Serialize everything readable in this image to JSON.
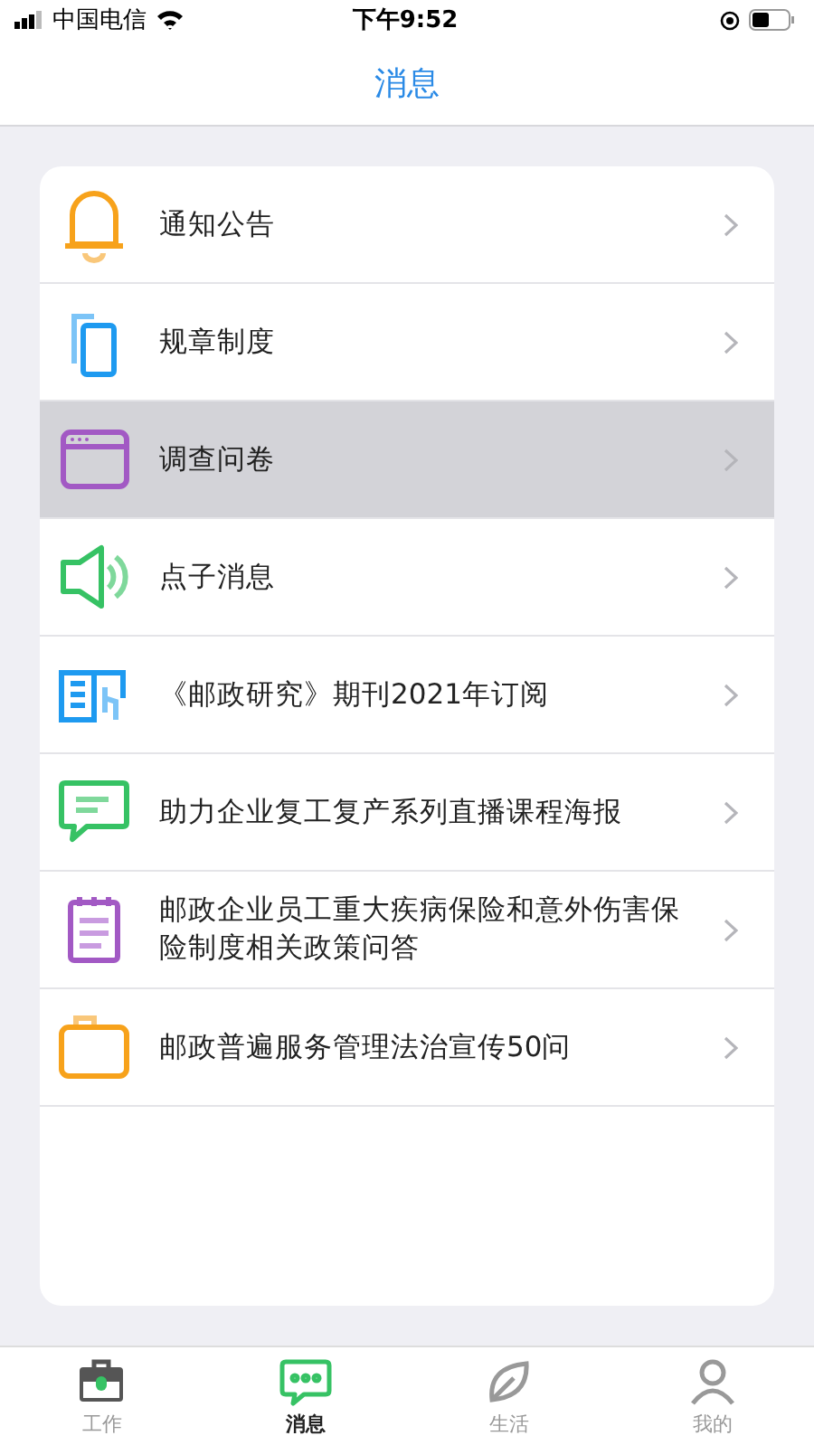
{
  "status_bar": {
    "carrier": "中国电信",
    "time": "下午9:52"
  },
  "header": {
    "title": "消息"
  },
  "items": [
    {
      "kind": "bell",
      "label": "通知公告",
      "selected": false
    },
    {
      "kind": "copy",
      "label": "规章制度",
      "selected": false
    },
    {
      "kind": "window",
      "label": "调查问卷",
      "selected": true
    },
    {
      "kind": "speaker",
      "label": "点子消息",
      "selected": false
    },
    {
      "kind": "book",
      "label": "《邮政研究》期刊2021年订阅",
      "selected": false
    },
    {
      "kind": "chat",
      "label": "助力企业复工复产系列直播课程海报",
      "selected": false
    },
    {
      "kind": "notepad",
      "label": "邮政企业员工重大疾病保险和意外伤害保险制度相关政策问答",
      "selected": false
    },
    {
      "kind": "folder",
      "label": "邮政普遍服务管理法治宣传50问",
      "selected": false
    }
  ],
  "tabs": [
    {
      "kind": "work",
      "label": "工作",
      "selected": false
    },
    {
      "kind": "message",
      "label": "消息",
      "selected": true
    },
    {
      "kind": "life",
      "label": "生活",
      "selected": false
    },
    {
      "kind": "me",
      "label": "我的",
      "selected": false
    }
  ]
}
